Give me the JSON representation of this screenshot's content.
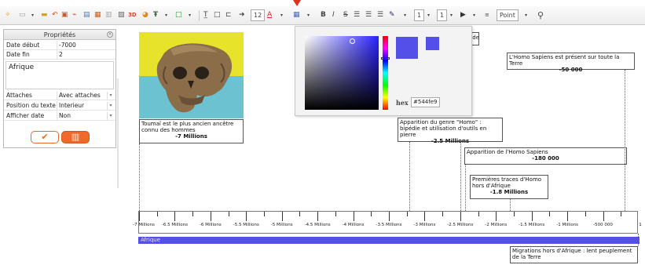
{
  "toolbar": {
    "font_size": "12",
    "line_width_a": "1",
    "line_width_b": "1",
    "unit": "Point"
  },
  "panel": {
    "title": "Propriétés",
    "rows": [
      {
        "label": "Date début",
        "value": "-7000"
      },
      {
        "label": "Date fin",
        "value": "2"
      },
      {
        "label": "Attaches",
        "value": "Avec attaches"
      },
      {
        "label": "Position du texte",
        "value": "Interieur"
      },
      {
        "label": "Afficher date",
        "value": "Non"
      }
    ],
    "text_value": "Afrique"
  },
  "picker": {
    "hex_label": "hex",
    "hex_value": "#544fe9",
    "color": "#544fe9"
  },
  "events": {
    "toumai": {
      "text": "Toumaï est le plus ancien ancêtre connu des hommes",
      "date": "-7 Millions"
    },
    "homo_genre": {
      "text": "Apparition du genre \"Homo\" : bipédie et utilisation d'outils en pierre",
      "date": "-2.5 Millions"
    },
    "sapiens": {
      "text": "Apparition de l'Homo Sapiens",
      "date": "-180 000"
    },
    "traces": {
      "text": "Premières traces d'Homo hors d'Afrique",
      "date": "-1.8 Millions"
    },
    "toute_terre": {
      "text": "L'Homo Sapiens est présent sur toute la Terre",
      "date": "-50 000"
    },
    "migrations": {
      "text": "Migrations hors d'Afrique : lent peuplement de la Terre"
    },
    "partial_label": "ede"
  },
  "axis": {
    "tick_labels": [
      "-7 Millions",
      "-6.5 Millions",
      "-6 Millions",
      "-5.5 Millions",
      "-5 Millions",
      "-4.5 Millions",
      "-4 Millions",
      "-3.5 Millions",
      "-3 Millions",
      "-2.5 Millions",
      "-2 Millions",
      "-1.5 Millions",
      "-1 Millions",
      "-500 000"
    ],
    "end_label": "1"
  },
  "bar": {
    "label": "Afrique",
    "color": "#544fe9"
  },
  "icons": [
    "new-file-icon",
    "open-folder-icon",
    "undo-icon",
    "save-icon",
    "image-icon",
    "3d-icon",
    "text-icon",
    "frame-icon",
    "bold-icon",
    "italic-icon",
    "strikethrough-icon",
    "align-left-icon",
    "align-center-icon",
    "align-right-icon",
    "pen-icon",
    "arrow-icon",
    "location-pin-icon"
  ]
}
